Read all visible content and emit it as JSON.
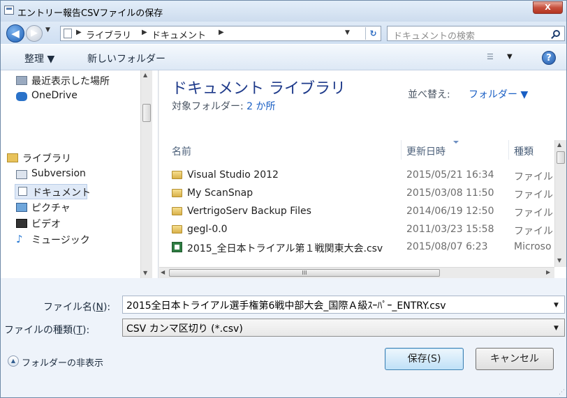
{
  "title": "エントリー報告CSVファイルの保存",
  "close_glyph": "X",
  "nav": {
    "back_glyph": "◀",
    "forward_glyph": "▶",
    "dropdown_glyph": "▼"
  },
  "address": {
    "crumbs": [
      "ライブラリ",
      "ドキュメント"
    ],
    "separator": "▶",
    "dropdown_glyph": "▼",
    "refresh_glyph": "↻"
  },
  "search": {
    "placeholder": "ドキュメントの検索"
  },
  "toolbar": {
    "organize": "整理 ▼",
    "new_folder": "新しいフォルダー",
    "view_glyph": "☰",
    "view_dropdown": "▼",
    "help_glyph": "?"
  },
  "sidebar": {
    "items": [
      {
        "label": "最近表示した場所",
        "icon": "recent-places-icon"
      },
      {
        "label": "OneDrive",
        "icon": "onedrive-icon"
      },
      {
        "label": "ライブラリ",
        "icon": "library-icon"
      },
      {
        "label": "Subversion",
        "icon": "subversion-icon"
      },
      {
        "label": "ドキュメント",
        "icon": "documents-icon",
        "selected": true
      },
      {
        "label": "ピクチャ",
        "icon": "pictures-icon"
      },
      {
        "label": "ビデオ",
        "icon": "videos-icon"
      },
      {
        "label": "ミュージック",
        "icon": "music-icon"
      }
    ]
  },
  "library": {
    "title": "ドキュメント ライブラリ",
    "subtitle_prefix": "対象フォルダー: ",
    "subtitle_link": "2 か所",
    "sort_label": "並べ替え:",
    "sort_value": "フォルダー ▼"
  },
  "columns": {
    "name": "名前",
    "date": "更新日時",
    "type": "種類"
  },
  "files": [
    {
      "name": "Visual Studio 2012",
      "date": "2015/05/21 16:34",
      "type": "ファイル フ",
      "kind": "folder"
    },
    {
      "name": "My ScanSnap",
      "date": "2015/03/08 11:50",
      "type": "ファイル フ",
      "kind": "folder"
    },
    {
      "name": "VertrigoServ Backup Files",
      "date": "2014/06/19 12:50",
      "type": "ファイル フ",
      "kind": "folder"
    },
    {
      "name": "gegl-0.0",
      "date": "2011/03/23 15:58",
      "type": "ファイル フ",
      "kind": "folder"
    },
    {
      "name": "2015_全日本トライアル第１戦関東大会.csv",
      "date": "2015/08/07 6:23",
      "type": "Microso",
      "kind": "csv"
    }
  ],
  "hscroll_grip": "III",
  "form": {
    "filename_label_pre": "ファイル名(",
    "filename_label_key": "N",
    "filename_label_post": "):",
    "filename_value": "2015全日本トライアル選手権第6戦中部大会_国際Ａ級ｽｰﾊﾟｰ_ENTRY.csv",
    "filetype_label_pre": "ファイルの種類(",
    "filetype_label_key": "T",
    "filetype_label_post": "):",
    "filetype_value": "CSV カンマ区切り (*.csv)",
    "dropdown_glyph": "▼"
  },
  "hide_folders": {
    "label": "フォルダーの非表示",
    "glyph": "▲"
  },
  "buttons": {
    "save": "保存(S)",
    "cancel": "キャンセル"
  },
  "grip_glyph": "⋰"
}
